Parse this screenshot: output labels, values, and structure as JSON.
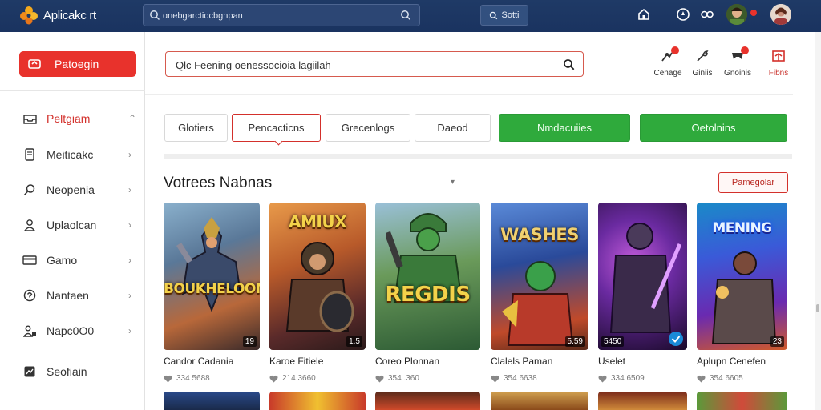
{
  "app": {
    "brand": "Aplicakc rt",
    "accent": "#e8322c",
    "topbar_color": "#1f3a66"
  },
  "topbar": {
    "search_value": "ɑnebgarctiocbgnpan",
    "search_button_label": "Sotti",
    "icons": [
      "home-icon",
      "compass-icon",
      "gamepad-icon",
      "user-avatar",
      "profile-avatar"
    ]
  },
  "sidebar": {
    "primary_button": "Patoegin",
    "items": [
      {
        "label": "Peltgiam",
        "icon": "inbox-icon",
        "active": true,
        "chevron": "⌃"
      },
      {
        "label": "Meiticakc",
        "icon": "device-icon",
        "active": false,
        "chevron": "›"
      },
      {
        "label": "Neopenia",
        "icon": "search-icon",
        "active": false,
        "chevron": "›"
      },
      {
        "label": "Uplaolcan",
        "icon": "user-icon",
        "active": false,
        "chevron": "›"
      },
      {
        "label": "Gamo",
        "icon": "card-icon",
        "active": false,
        "chevron": "›"
      },
      {
        "label": "Nantaen",
        "icon": "help-icon",
        "active": false,
        "chevron": "›"
      },
      {
        "label": "Napc0O0",
        "icon": "people-icon",
        "active": false,
        "chevron": "›"
      },
      {
        "label": "Seofiain",
        "icon": "chart-icon",
        "active": false,
        "chevron": ""
      }
    ]
  },
  "header": {
    "search_value": "Qlc Feening oenessocioia lagiilah",
    "actions": [
      {
        "label": "Cenage",
        "icon": "gear-icon",
        "badge": true
      },
      {
        "label": "Giniis",
        "icon": "tool-icon",
        "badge": false
      },
      {
        "label": "Gnoinis",
        "icon": "controller-icon",
        "badge": true
      },
      {
        "label": "Fibns",
        "icon": "gift-icon",
        "badge": false
      }
    ]
  },
  "filters": [
    {
      "label": "Glotiers",
      "selected": false,
      "green": false
    },
    {
      "label": "Pencacticns",
      "selected": true,
      "green": false
    },
    {
      "label": "Grecenlogs",
      "selected": false,
      "green": false
    },
    {
      "label": "Daeod",
      "selected": false,
      "green": false
    },
    {
      "label": "Nmdacuiies",
      "selected": false,
      "green": true
    },
    {
      "label": "Oetolnins",
      "selected": false,
      "green": true
    }
  ],
  "section": {
    "title": "Votrees Nabnas",
    "caret": "▾",
    "button_label": "Pamegolar"
  },
  "games": [
    {
      "name": "Candor Cadania",
      "meta": "334 5688",
      "rating": "19",
      "art_title": "BOUKHELOOM",
      "palette": [
        "#6b8fb0",
        "#b8663a",
        "#2c2c3e"
      ]
    },
    {
      "name": "Karoe Fitiele",
      "meta": "214 3660",
      "rating": "1.5",
      "art_title": "AMIUX",
      "palette": [
        "#d07a3a",
        "#6a3a2a",
        "#3a2a2e"
      ]
    },
    {
      "name": "Coreo Plonnan",
      "meta": "354 .360",
      "rating": "",
      "art_title": "REGDIS",
      "palette": [
        "#4a9a4e",
        "#2c6b34",
        "#d8b040"
      ]
    },
    {
      "name": "Clalels Paman",
      "meta": "354 6638",
      "rating": "5.59",
      "art_title": "WASHES",
      "palette": [
        "#3a6ab8",
        "#c4401e",
        "#1a2a5a"
      ]
    },
    {
      "name": "Uselet",
      "meta": "334 6509",
      "rating": "5450",
      "art_title": "",
      "palette": [
        "#7a3ab8",
        "#2a1a4a",
        "#c04ad0"
      ]
    },
    {
      "name": "Aplupn Cenefen",
      "meta": "354 6605",
      "rating": "23",
      "art_title": "MENING",
      "palette": [
        "#1a8ac8",
        "#6a2ab0",
        "#d05a2a"
      ]
    }
  ],
  "row2_palettes": [
    [
      "#2a4a8a",
      "#1a2a4a"
    ],
    [
      "#c83a2a",
      "#f0c030"
    ],
    [
      "#5a2a1a",
      "#d04a2a"
    ],
    [
      "#d0a050",
      "#8a4a1a"
    ],
    [
      "#7a2a1a",
      "#d08a3a"
    ],
    [
      "#5a9a3a",
      "#d04a3a"
    ]
  ]
}
